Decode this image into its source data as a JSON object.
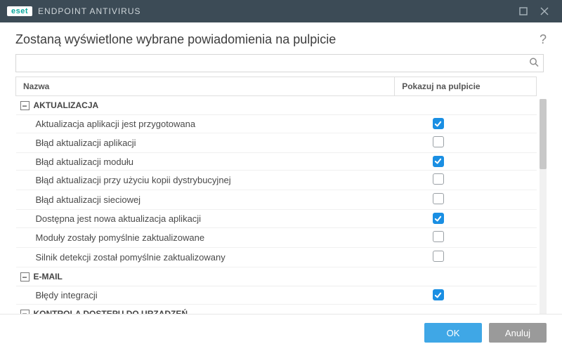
{
  "window": {
    "brand_logo": "eset",
    "brand_text": "ENDPOINT ANTIVIRUS"
  },
  "header": {
    "title": "Zostaną wyświetlone wybrane powiadomienia na pulpicie"
  },
  "search": {
    "value": "",
    "placeholder": ""
  },
  "columns": {
    "name": "Nazwa",
    "show": "Pokazuj na pulpicie"
  },
  "groups": [
    {
      "label": "AKTUALIZACJA",
      "expanded": true,
      "items": [
        {
          "label": "Aktualizacja aplikacji jest przygotowana",
          "checked": true
        },
        {
          "label": "Błąd aktualizacji aplikacji",
          "checked": false
        },
        {
          "label": "Błąd aktualizacji modułu",
          "checked": true
        },
        {
          "label": "Błąd aktualizacji przy użyciu kopii dystrybucyjnej",
          "checked": false
        },
        {
          "label": "Błąd aktualizacji sieciowej",
          "checked": false
        },
        {
          "label": "Dostępna jest nowa aktualizacja aplikacji",
          "checked": true
        },
        {
          "label": "Moduły zostały pomyślnie zaktualizowane",
          "checked": false
        },
        {
          "label": "Silnik detekcji został pomyślnie zaktualizowany",
          "checked": false
        }
      ]
    },
    {
      "label": "E-MAIL",
      "expanded": true,
      "items": [
        {
          "label": "Błędy integracji",
          "checked": true
        }
      ]
    },
    {
      "label": "KONTROLA DOSTĘPU DO URZĄDZEŃ",
      "expanded": true,
      "items": []
    }
  ],
  "buttons": {
    "ok": "OK",
    "cancel": "Anuluj"
  },
  "icons": {
    "group_toggle_minus": "−"
  }
}
